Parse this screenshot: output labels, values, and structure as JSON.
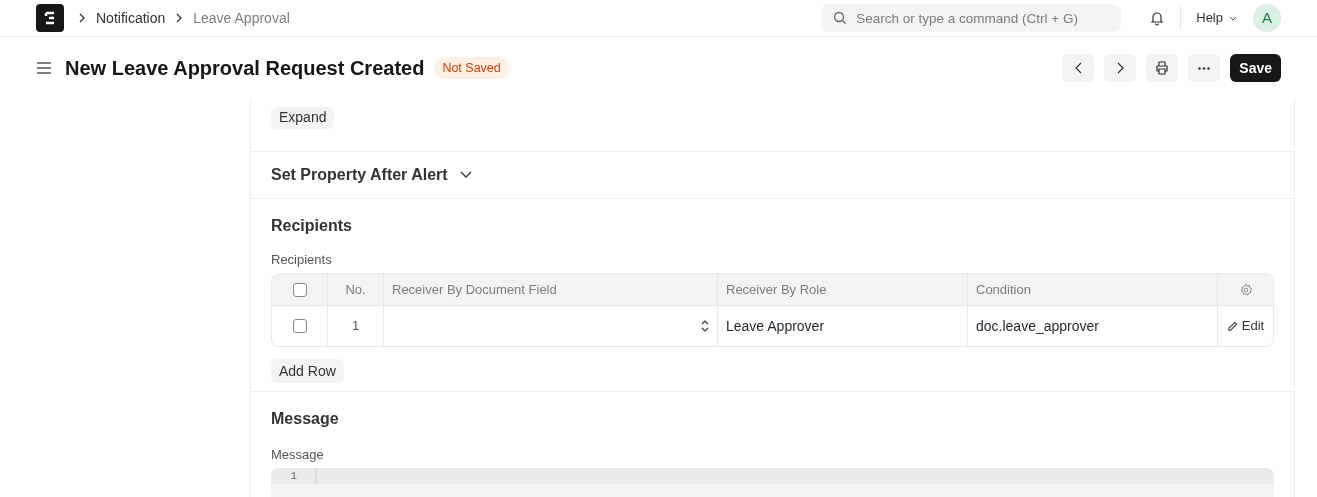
{
  "navbar": {
    "breadcrumbs": [
      {
        "label": "Notification",
        "current": false
      },
      {
        "label": "Leave Approval",
        "current": true
      }
    ],
    "search": {
      "placeholder": "Search or type a command (Ctrl + G)"
    },
    "help": "Help",
    "avatar": "A"
  },
  "page_header": {
    "title": "New Leave Approval Request Created",
    "status": "Not Saved",
    "save": "Save"
  },
  "expand_button": "Expand",
  "set_property_section": {
    "title": "Set Property After Alert",
    "expanded": false
  },
  "recipients_section": {
    "title": "Recipients",
    "field_label": "Recipients",
    "table": {
      "select_all": {
        "checked": false
      },
      "columns": [
        "No.",
        "Receiver By Document Field",
        "Receiver By Role",
        "Condition"
      ],
      "rows": [
        {
          "checked": false,
          "cells": [
            "1",
            "",
            "Leave Approver",
            "doc.leave_approver"
          ],
          "edit": "Edit"
        }
      ]
    },
    "add_row": "Add Row"
  },
  "message_section": {
    "title": "Message",
    "field_label": "Message",
    "editor": {
      "line_numbers": [
        "1"
      ]
    }
  }
}
